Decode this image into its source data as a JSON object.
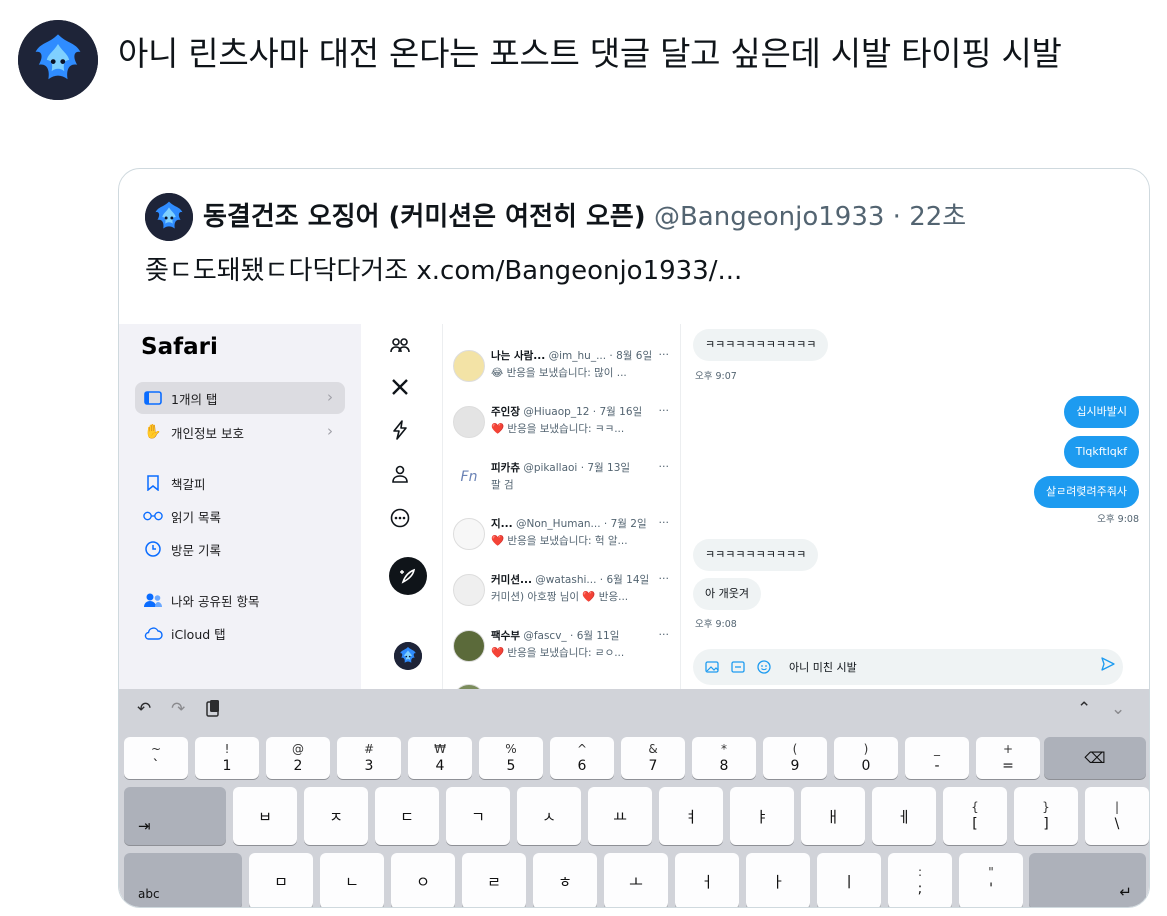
{
  "tweet": {
    "text": "아니 린츠사마 대전 온다는 포스트 댓글 달고 싶은데 시발 타이핑 시발"
  },
  "quote": {
    "display_name": "동결건조 오징어 (커미션은 여전히 오픈)",
    "handle": "@Bangeonjo1933",
    "separator": "·",
    "time": "22초",
    "text": "좆ㄷ도돼됐ㄷ다닥다거조  x.com/Bangeonjo1933/..."
  },
  "sidebar": {
    "title": "Safari",
    "items": [
      {
        "label": "1개의 탭",
        "icon": "tabs-icon"
      },
      {
        "label": "개인정보 보호",
        "icon": "hand-icon"
      },
      {
        "label": "책갈피",
        "icon": "bookmark-icon"
      },
      {
        "label": "읽기 목록",
        "icon": "glasses-icon"
      },
      {
        "label": "방문 기록",
        "icon": "clock-icon"
      },
      {
        "label": "나와 공유된 항목",
        "icon": "people-icon"
      },
      {
        "label": "iCloud 탭",
        "icon": "cloud-icon"
      }
    ]
  },
  "nav": {
    "icons": [
      "communities-icon",
      "x-logo-icon",
      "lightning-icon",
      "profile-icon",
      "more-icon"
    ]
  },
  "notifications": [
    {
      "name": "나는 사람...",
      "handle": "@im_hu_...",
      "date": "· 8월 6일",
      "body": "😂 반응을 보냈습니다: 많이 ..."
    },
    {
      "name": "주인장",
      "handle": "@Hiuaop_12",
      "date": "· 7월 16일",
      "body": "❤️ 반응을 보냈습니다: ㅋㅋ..."
    },
    {
      "name": "피카츄",
      "handle": "@pikallaoi",
      "date": "· 7월 13일",
      "body": "팔 검"
    },
    {
      "name": "지...",
      "handle": "@Non_Human...",
      "date": "· 7월 2일",
      "body": "❤️ 반응을 보냈습니다: 헉 알..."
    },
    {
      "name": "커미션...",
      "handle": "@watashi...",
      "date": "· 6월 14일",
      "body": "커미션) 아호짱 님이 ❤️ 반응..."
    },
    {
      "name": "팩수부",
      "handle": "@fascv_",
      "date": "· 6월 11일",
      "body": "❤️ 반응을 보냈습니다: ㄹㅇ..."
    }
  ],
  "more_glyph": "···",
  "chat": {
    "msg1": "ㅋㅋㅋㅋㅋㅋㅋㅋㅋㅋㅋ",
    "time1": "오후 9:07",
    "msg2": "십시바발시",
    "msg3": "Tlqkftlqkf",
    "msg4": "살ㄹ려렺려주줘사",
    "time2": "오후 9:08",
    "msg5": "ㅋㅋㅋㅋㅋㅋㅋㅋㅋㅋ",
    "msg6": "아 개웃겨",
    "time3": "오후 9:08",
    "input_value": "아니 미친 시발"
  },
  "keyboard": {
    "row1": [
      {
        "top": "~",
        "bot": "`"
      },
      {
        "top": "!",
        "bot": "1"
      },
      {
        "top": "@",
        "bot": "2"
      },
      {
        "top": "#",
        "bot": "3"
      },
      {
        "top": "₩",
        "bot": "4"
      },
      {
        "top": "%",
        "bot": "5"
      },
      {
        "top": "^",
        "bot": "6"
      },
      {
        "top": "&",
        "bot": "7"
      },
      {
        "top": "*",
        "bot": "8"
      },
      {
        "top": "(",
        "bot": "9"
      },
      {
        "top": ")",
        "bot": "0"
      },
      {
        "top": "_",
        "bot": "-"
      },
      {
        "top": "+",
        "bot": "="
      }
    ],
    "row2": [
      {
        "single": "ㅂ"
      },
      {
        "single": "ㅈ"
      },
      {
        "single": "ㄷ"
      },
      {
        "single": "ㄱ"
      },
      {
        "single": "ㅅ"
      },
      {
        "single": "ㅛ"
      },
      {
        "single": "ㅕ"
      },
      {
        "single": "ㅑ"
      },
      {
        "single": "ㅐ"
      },
      {
        "single": "ㅔ"
      },
      {
        "top": "{",
        "bot": "["
      },
      {
        "top": "}",
        "bot": "]"
      },
      {
        "top": "|",
        "bot": "\\"
      }
    ],
    "row3": [
      {
        "single": "ㅁ"
      },
      {
        "single": "ㄴ"
      },
      {
        "single": "ㅇ"
      },
      {
        "single": "ㄹ"
      },
      {
        "single": "ㅎ"
      },
      {
        "single": "ㅗ"
      },
      {
        "single": "ㅓ"
      },
      {
        "single": "ㅏ"
      },
      {
        "single": "ㅣ"
      },
      {
        "top": ":",
        "bot": ";"
      },
      {
        "top": "\"",
        "bot": "'"
      }
    ],
    "caps_label": "abc",
    "tab_glyph": "⇥",
    "delete_glyph": "⌫",
    "return_glyph": "↵"
  }
}
